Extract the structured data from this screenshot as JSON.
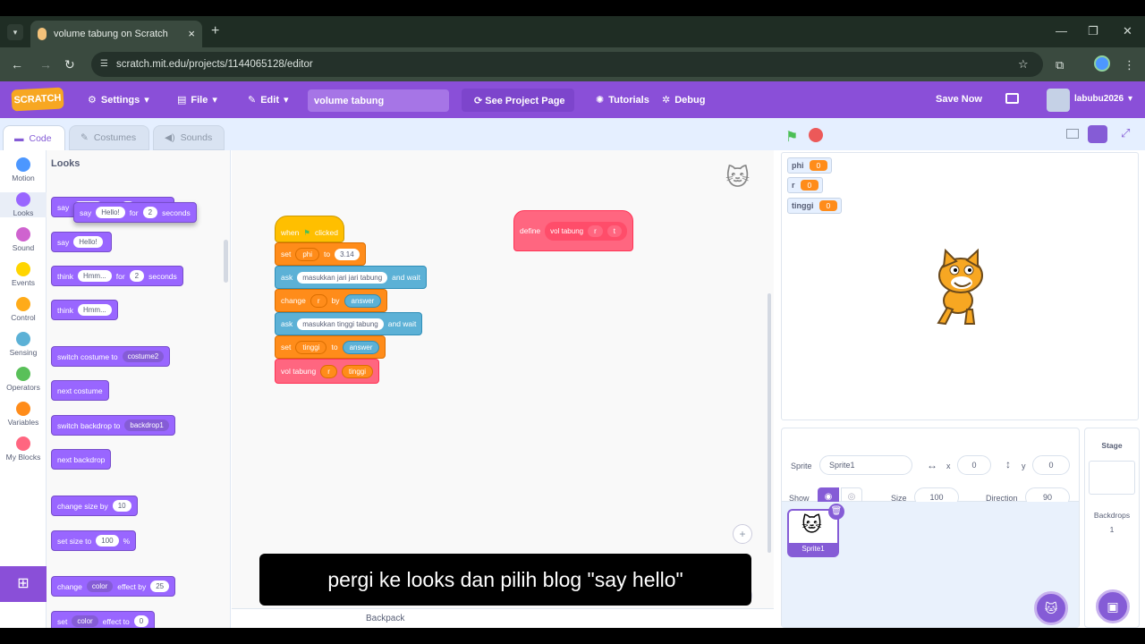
{
  "browser": {
    "tab_title": "volume tabung on Scratch",
    "url": "scratch.mit.edu/projects/1144065128/editor",
    "tab_close": "×",
    "new_tab": "+"
  },
  "menu": {
    "logo": "SCRATCH",
    "settings": "Settings",
    "file": "File",
    "edit": "Edit",
    "project_title": "volume tabung",
    "see_project": "See Project Page",
    "tutorials": "Tutorials",
    "debug": "Debug",
    "save_now": "Save Now",
    "username": "labubu2026"
  },
  "editor_tabs": {
    "code": "Code",
    "costumes": "Costumes",
    "sounds": "Sounds"
  },
  "categories": [
    {
      "label": "Motion",
      "color": "#4c97ff"
    },
    {
      "label": "Looks",
      "color": "#9966ff"
    },
    {
      "label": "Sound",
      "color": "#cf63cf"
    },
    {
      "label": "Events",
      "color": "#ffd500"
    },
    {
      "label": "Control",
      "color": "#ffab19"
    },
    {
      "label": "Sensing",
      "color": "#5cb1d6"
    },
    {
      "label": "Operators",
      "color": "#59c059"
    },
    {
      "label": "Variables",
      "color": "#ff8c1a"
    },
    {
      "label": "My Blocks",
      "color": "#ff6680"
    }
  ],
  "palette": {
    "title": "Looks",
    "say_for": {
      "say": "say",
      "text": "Hello!",
      "for": "for",
      "secs": "2",
      "seconds": "seconds"
    },
    "say": {
      "say": "say",
      "text": "Hello!"
    },
    "think_for": {
      "think": "think",
      "text": "Hmm...",
      "for": "for",
      "secs": "2",
      "seconds": "seconds"
    },
    "think": {
      "think": "think",
      "text": "Hmm..."
    },
    "switch_costume": {
      "label": "switch costume to",
      "value": "costume2"
    },
    "next_costume": "next costume",
    "switch_backdrop": {
      "label": "switch backdrop to",
      "value": "backdrop1"
    },
    "next_backdrop": "next backdrop",
    "change_size": {
      "label": "change size by",
      "value": "10"
    },
    "set_size": {
      "label": "set size to",
      "value": "100",
      "unit": "%"
    },
    "change_effect": {
      "change": "change",
      "effect": "color",
      "label": "effect by",
      "value": "25"
    },
    "set_effect": {
      "set": "set",
      "effect": "color",
      "label": "effect to",
      "value": "0"
    }
  },
  "script": {
    "hat": {
      "when": "when",
      "clicked": "clicked"
    },
    "set_phi": {
      "set": "set",
      "var": "phi",
      "to": "to",
      "value": "3.14"
    },
    "ask1": {
      "ask": "ask",
      "text": "masukkan jari jari tabung",
      "wait": "and wait"
    },
    "change_r": {
      "change": "change",
      "var": "r",
      "by": "by",
      "value": "answer"
    },
    "ask2": {
      "ask": "ask",
      "text": "masukkan tinggi tabung",
      "wait": "and wait"
    },
    "set_tinggi": {
      "set": "set",
      "var": "tinggi",
      "to": "to",
      "value": "answer"
    },
    "call": {
      "name": "vol tabung",
      "arg1": "r",
      "arg2": "tinggi"
    },
    "define": {
      "define": "define",
      "name": "vol tabung",
      "arg1": "r",
      "arg2": "t"
    }
  },
  "backpack": "Backpack",
  "monitors": [
    {
      "name": "phi",
      "value": "0"
    },
    {
      "name": "r",
      "value": "0"
    },
    {
      "name": "tinggi",
      "value": "0"
    }
  ],
  "sprite_info": {
    "sprite_label": "Sprite",
    "sprite_name": "Sprite1",
    "x_label": "x",
    "x": "0",
    "y_label": "y",
    "y": "0",
    "show_label": "Show",
    "size_label": "Size",
    "size": "100",
    "direction_label": "Direction",
    "direction": "90"
  },
  "sprite_tile": "Sprite1",
  "stage_pane": {
    "title": "Stage",
    "backdrops_label": "Backdrops",
    "backdrops": "1"
  },
  "caption": "pergi ke looks dan pilih blog \"say hello\""
}
